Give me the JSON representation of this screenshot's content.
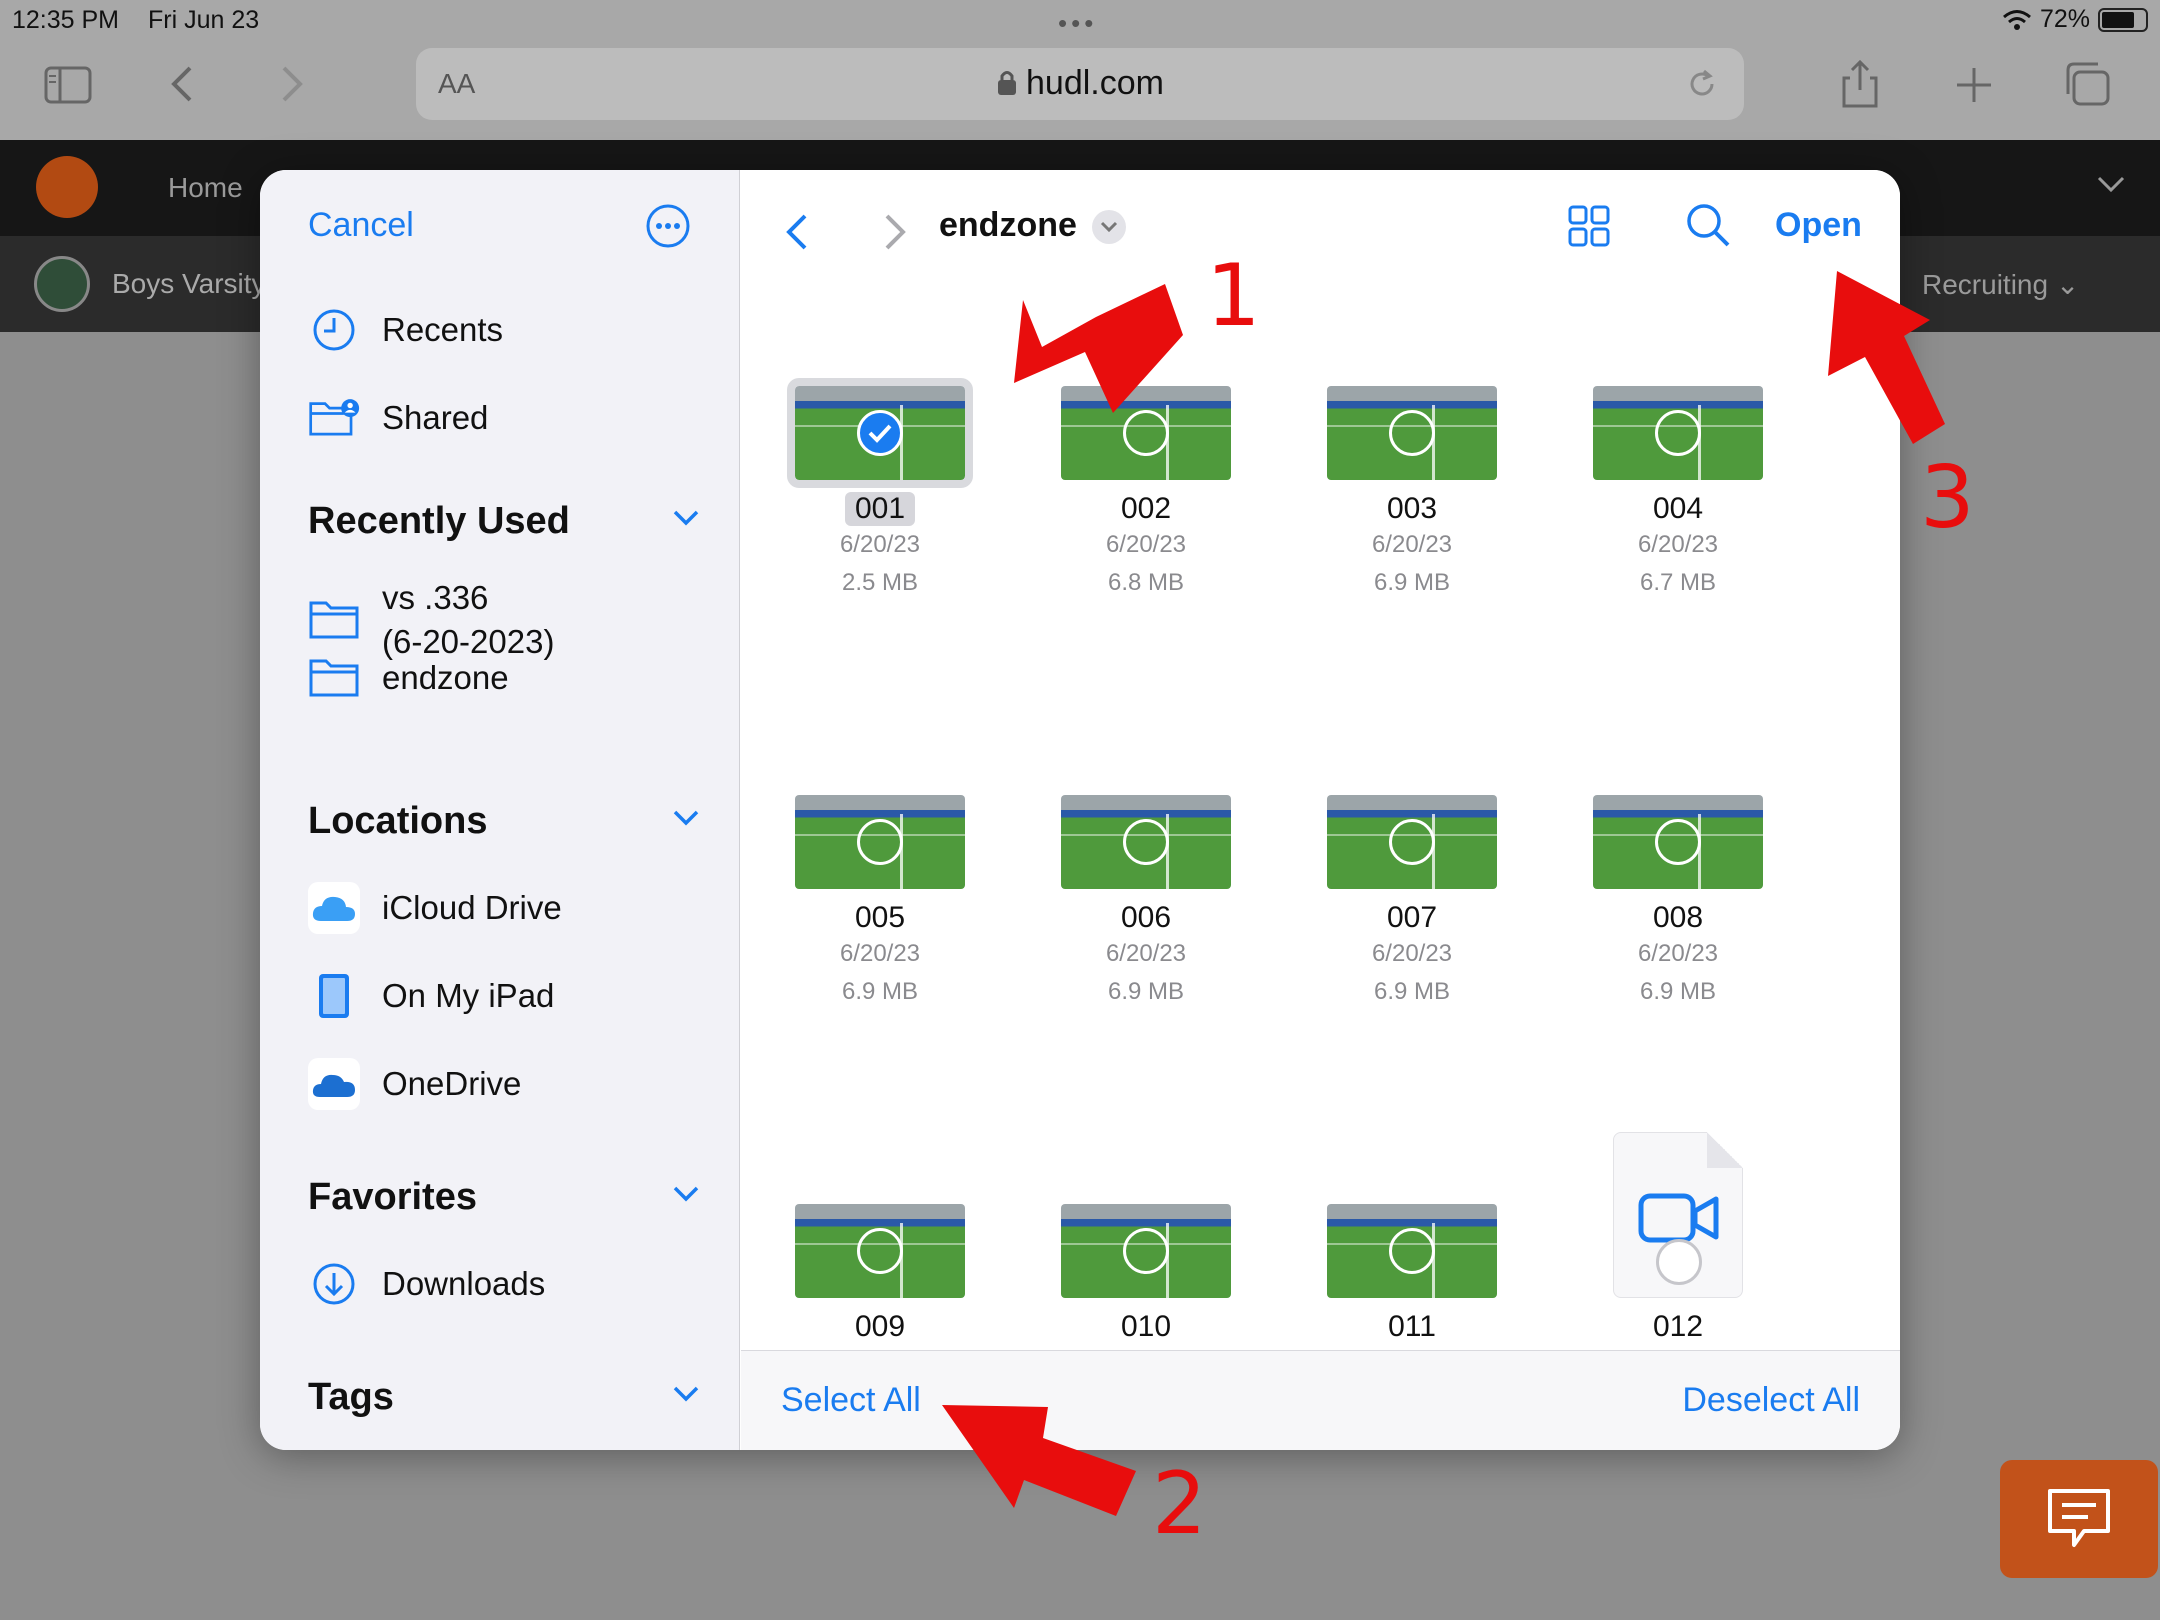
{
  "status_bar": {
    "time": "12:35 PM",
    "date": "Fri Jun 23",
    "battery": "72%"
  },
  "safari": {
    "reader_label": "AA",
    "host": "hudl.com"
  },
  "hudl": {
    "home_label": "Home",
    "team_label": "Boys Varsity",
    "recruiting_label": "Recruiting"
  },
  "sidebar": {
    "cancel_label": "Cancel",
    "top_items": [
      {
        "label": "Recents",
        "icon": "clock-icon"
      },
      {
        "label": "Shared",
        "icon": "shared-folder-icon"
      }
    ],
    "sections": {
      "recently_used": {
        "title": "Recently Used",
        "items": [
          {
            "label": "vs .336\n(6-20-2023)"
          },
          {
            "label": "endzone"
          }
        ]
      },
      "locations": {
        "title": "Locations",
        "items": [
          {
            "label": "iCloud Drive"
          },
          {
            "label": "On My iPad"
          },
          {
            "label": "OneDrive"
          }
        ]
      },
      "favorites": {
        "title": "Favorites",
        "items": [
          {
            "label": "Downloads"
          }
        ]
      },
      "tags": {
        "title": "Tags"
      }
    }
  },
  "browser": {
    "folder_title": "endzone",
    "open_label": "Open",
    "select_all_label": "Select All",
    "deselect_all_label": "Deselect All",
    "files": [
      {
        "name": "001",
        "date": "6/20/23",
        "size": "2.5 MB",
        "selected": true
      },
      {
        "name": "002",
        "date": "6/20/23",
        "size": "6.8 MB"
      },
      {
        "name": "003",
        "date": "6/20/23",
        "size": "6.9 MB"
      },
      {
        "name": "004",
        "date": "6/20/23",
        "size": "6.7 MB"
      },
      {
        "name": "005",
        "date": "6/20/23",
        "size": "6.9 MB"
      },
      {
        "name": "006",
        "date": "6/20/23",
        "size": "6.9 MB"
      },
      {
        "name": "007",
        "date": "6/20/23",
        "size": "6.9 MB"
      },
      {
        "name": "008",
        "date": "6/20/23",
        "size": "6.9 MB"
      },
      {
        "name": "009"
      },
      {
        "name": "010"
      },
      {
        "name": "011"
      },
      {
        "name": "012",
        "icon": "video-file-icon"
      }
    ]
  },
  "annotations": {
    "step1": "1",
    "step2": "2",
    "step3": "3"
  },
  "colors": {
    "accent": "#1a7cf0",
    "annotation": "#e80d0d",
    "hudl_orange": "#c2521a"
  }
}
